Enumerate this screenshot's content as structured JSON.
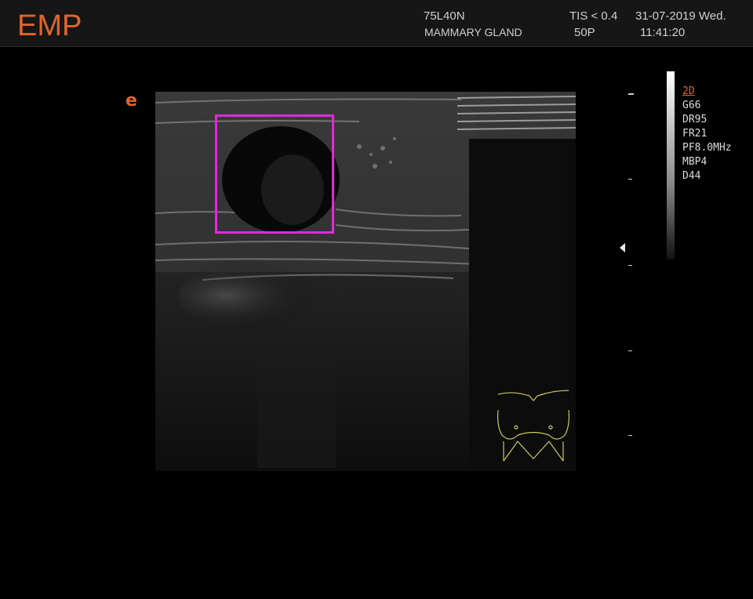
{
  "header": {
    "logo": "EMP",
    "probe": "75L40N",
    "exam": "MAMMARY GLAND",
    "tis": "TIS < 0.4",
    "preset": "50P",
    "date": "31-07-2019 Wed.",
    "time": "11:41:20"
  },
  "e_icon": "e",
  "parameters": {
    "mode": "2D",
    "items": [
      "G66",
      "DR95",
      "FR21",
      "PF8.0MHz",
      "MBP4",
      "D44"
    ]
  },
  "colors": {
    "accent": "#e0652f",
    "roi": "#e02ad8",
    "bodymark": "#c9c95a"
  },
  "icons": {
    "focus": "focus-marker-icon",
    "bodymark": "breast-bodymark-icon",
    "logo": "e-icon"
  }
}
